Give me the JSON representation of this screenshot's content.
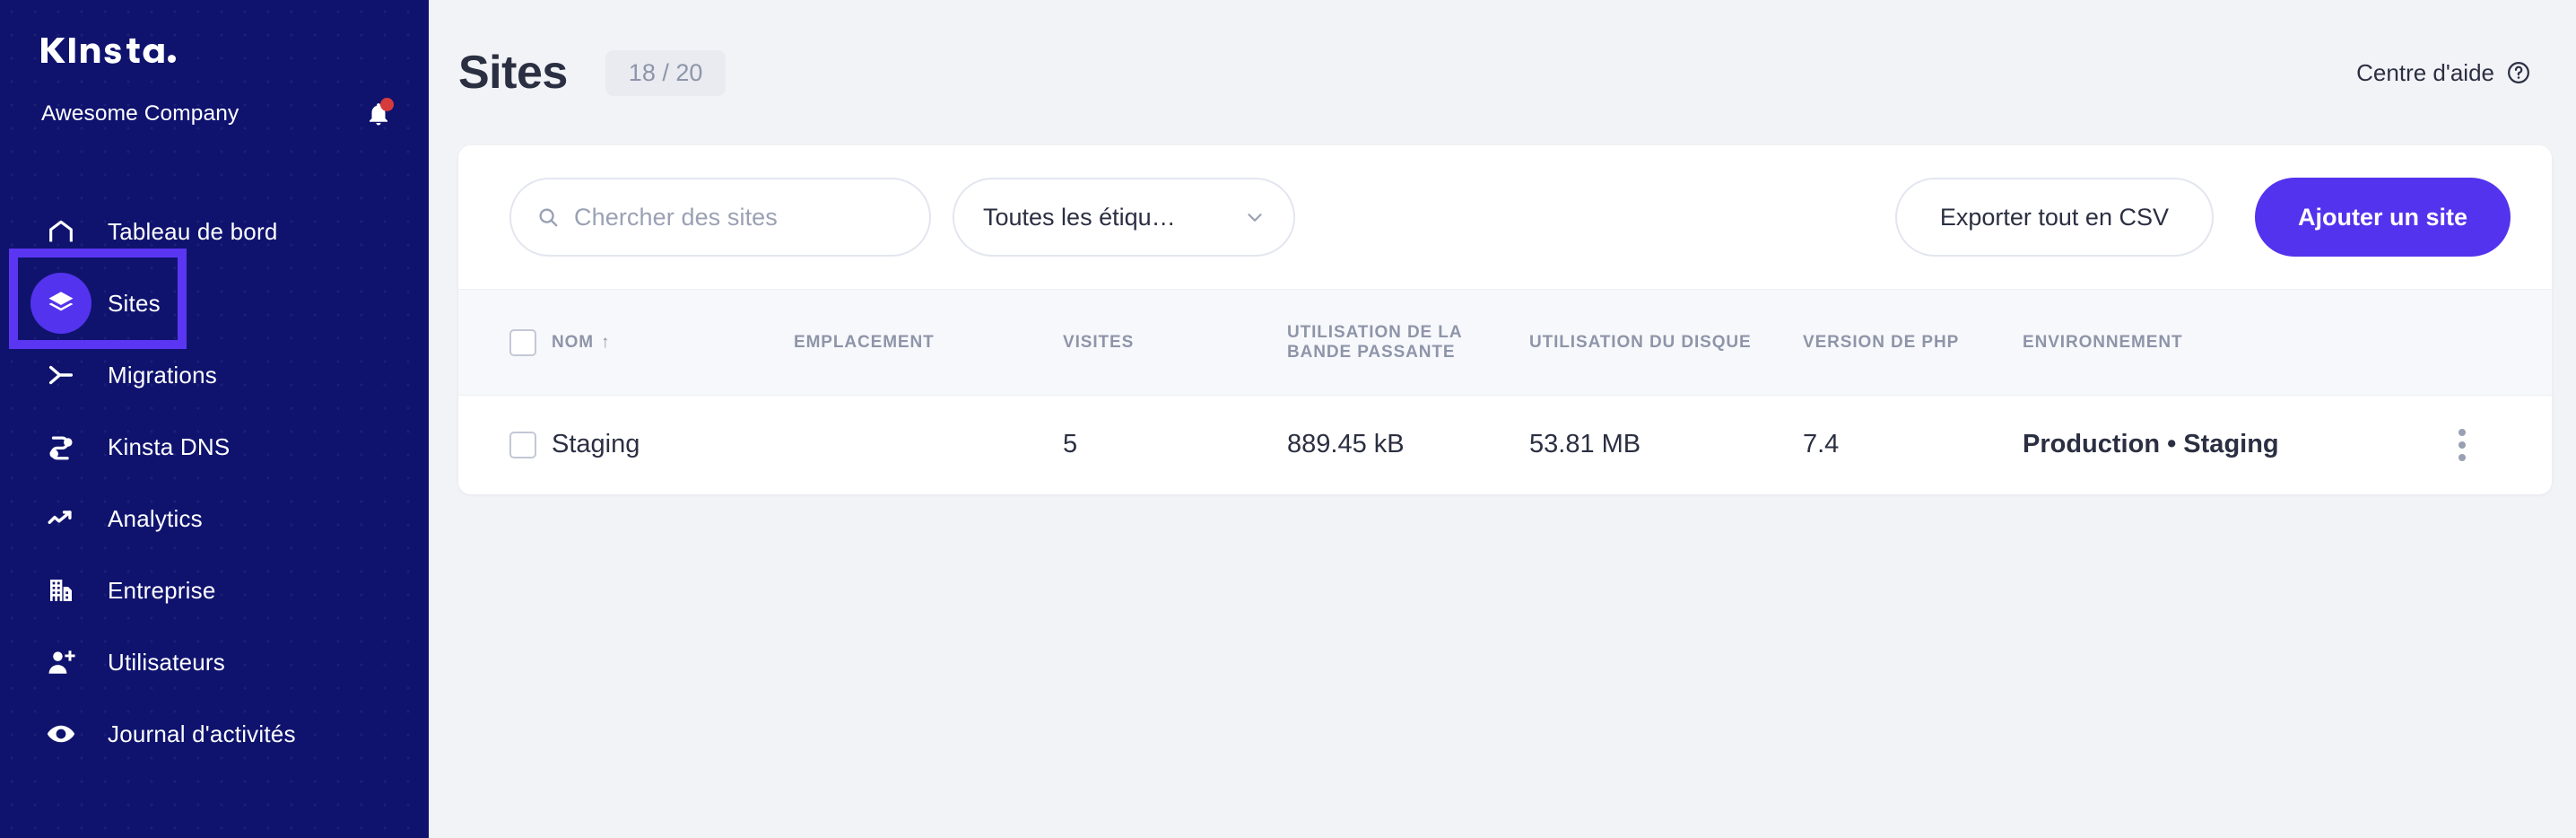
{
  "sidebar": {
    "logo_text": "Kinsta",
    "company_name": "Awesome Company",
    "notifications_icon": "bell-icon",
    "has_unread": true,
    "items": [
      {
        "label": "Tableau de bord",
        "icon": "home-icon",
        "active": false
      },
      {
        "label": "Sites",
        "icon": "layers-icon",
        "active": true
      },
      {
        "label": "Migrations",
        "icon": "migration-icon",
        "active": false
      },
      {
        "label": "Kinsta DNS",
        "icon": "dns-icon",
        "active": false
      },
      {
        "label": "Analytics",
        "icon": "trending-up-icon",
        "active": false
      },
      {
        "label": "Entreprise",
        "icon": "building-icon",
        "active": false
      },
      {
        "label": "Utilisateurs",
        "icon": "user-add-icon",
        "active": false
      },
      {
        "label": "Journal d'activités",
        "icon": "eye-icon",
        "active": false
      }
    ]
  },
  "header": {
    "title": "Sites",
    "count_badge": "18 / 20",
    "help_center_label": "Centre d'aide",
    "help_center_icon": "question-circle-icon"
  },
  "toolbar": {
    "search_placeholder": "Chercher des sites",
    "search_value": "",
    "search_icon": "search-icon",
    "tag_filter_value": "Toutes les étiqu…",
    "tag_filter_icon": "chevron-down-icon",
    "export_label": "Exporter tout en CSV",
    "add_site_label": "Ajouter un site"
  },
  "table": {
    "headers": {
      "select_all": "",
      "nom": "NOM",
      "nom_sort": "↑",
      "emplacement": "EMPLACEMENT",
      "visites": "VISITES",
      "bande_passante": "UTILISATION DE LA BANDE PASSANTE",
      "disque": "UTILISATION DU DISQUE",
      "php": "VERSION DE PHP",
      "environnement": "ENVIRONNEMENT"
    },
    "rows": [
      {
        "nom": "Staging",
        "emplacement": "",
        "visites": "5",
        "bande_passante": "889.45 kB",
        "disque": "53.81 MB",
        "php": "7.4",
        "environnement": "Production • Staging",
        "menu_icon": "kebab-menu-icon"
      }
    ]
  },
  "annotation": {
    "type": "highlight-box",
    "target": "sidebar-item-sites",
    "color": "#5b36f2"
  },
  "colors": {
    "sidebar_bg": "#0f136e",
    "accent": "#5333ed",
    "page_bg": "#f2f3f7",
    "card_bg": "#ffffff",
    "text_primary": "#2b2f42",
    "text_muted": "#8e95a9",
    "notification_dot": "#d63b3b"
  }
}
